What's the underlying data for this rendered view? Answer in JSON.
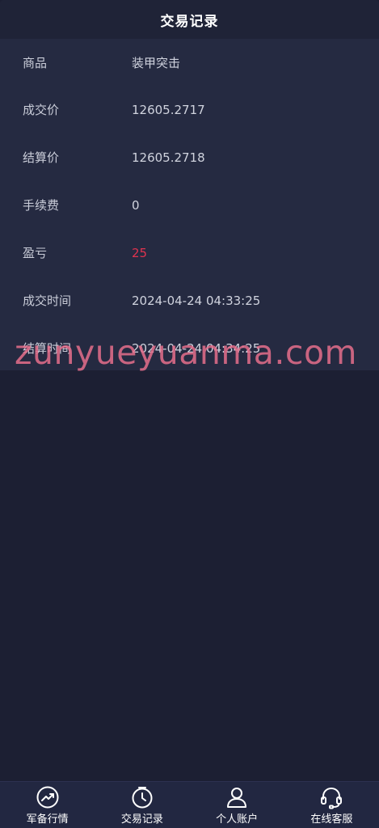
{
  "header": {
    "title": "交易记录"
  },
  "details": [
    {
      "label": "商品",
      "value": "装甲突击"
    },
    {
      "label": "成交价",
      "value": "12605.2717"
    },
    {
      "label": "结算价",
      "value": "12605.2718"
    },
    {
      "label": "手续费",
      "value": "0"
    },
    {
      "label": "盈亏",
      "value": "25"
    },
    {
      "label": "成交时间",
      "value": "2024-04-24 04:33:25"
    },
    {
      "label": "结算时间",
      "value": "2024-04-24 04:34:25"
    }
  ],
  "watermark": "zunyueyuanma.com",
  "tabbar": [
    {
      "label": "军备行情",
      "icon": "trend-up-icon"
    },
    {
      "label": "交易记录",
      "icon": "clock-icon"
    },
    {
      "label": "个人账户",
      "icon": "user-icon"
    },
    {
      "label": "在线客服",
      "icon": "headset-icon"
    }
  ],
  "colors": {
    "profit": "#e0334f",
    "background": "#1c1f33",
    "panel": "#252a41"
  }
}
